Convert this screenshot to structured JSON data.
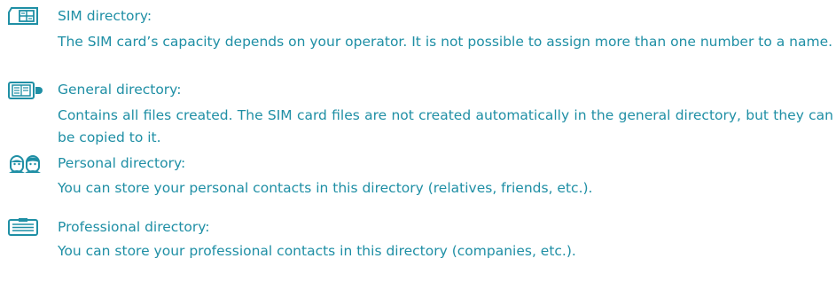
{
  "accent_color": "#1f8fa5",
  "entries": [
    {
      "icon": "sim-card-icon",
      "title": "SIM directory:",
      "description": "The SIM card’s capacity depends on your operator. It is not possible to assign more than one number to a name."
    },
    {
      "icon": "general-directory-icon",
      "title": "General directory:",
      "description": "Contains all files created. The SIM card files are not created automatically in the general directory, but they can be copied to it."
    },
    {
      "icon": "personal-contacts-icon",
      "title": "Personal directory:",
      "description": "You can store your personal contacts in this directory (relatives, friends, etc.)."
    },
    {
      "icon": "professional-directory-icon",
      "title": "Professional directory:",
      "description": "You can store your professional contacts in this directory (companies, etc.)."
    }
  ]
}
